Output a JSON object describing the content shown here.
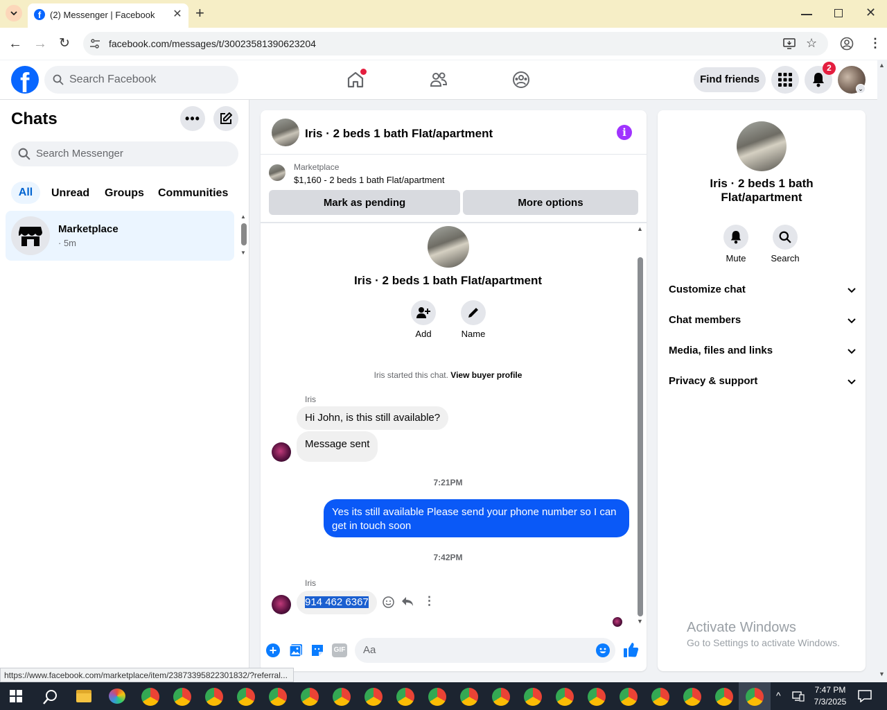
{
  "browser": {
    "tab_title": "(2) Messenger | Facebook",
    "url": "facebook.com/messages/t/30023581390623204",
    "status_url": "https://www.facebook.com/marketplace/item/23873395822301832/?referral..."
  },
  "header": {
    "search_placeholder": "Search Facebook",
    "find_friends": "Find friends",
    "notif_count": "2"
  },
  "left": {
    "title": "Chats",
    "search_placeholder": "Search Messenger",
    "filters": [
      "All",
      "Unread",
      "Groups",
      "Communities"
    ],
    "chat": {
      "name": "Marketplace",
      "time": "· 5m"
    }
  },
  "center": {
    "title": "Iris · 2 beds 1 bath Flat/apartment",
    "listing_source": "Marketplace",
    "listing_desc": "$1,160 - 2 beds 1 bath Flat/apartment",
    "mark_pending": "Mark as pending",
    "more_options": "More options",
    "profile_name": "Iris · 2 beds 1 bath Flat/apartment",
    "add_label": "Add",
    "name_label": "Name",
    "started_text": "Iris started this chat.",
    "view_buyer": "View buyer profile",
    "sender1": "Iris",
    "msg1": "Hi John, is this still available?",
    "msg2": "Message sent",
    "time1": "7:21PM",
    "msg3": "Yes its still available Please send your phone number so I can get in touch soon",
    "time2": "7:42PM",
    "sender2": "Iris",
    "msg4": "914 462 6367",
    "compose_placeholder": "Aa"
  },
  "right": {
    "name": "Iris · 2 beds 1 bath Flat/apartment",
    "mute": "Mute",
    "search": "Search",
    "sections": [
      "Customize chat",
      "Chat members",
      "Media, files and links",
      "Privacy & support"
    ]
  },
  "watermark": {
    "title": "Activate Windows",
    "subtitle": "Go to Settings to activate Windows."
  },
  "taskbar": {
    "time": "7:47 PM",
    "date": "7/3/2025"
  },
  "colors": {
    "fb_blue": "#0866ff",
    "messenger_blue": "#0a59f7",
    "accent_purple": "#a033ff"
  }
}
